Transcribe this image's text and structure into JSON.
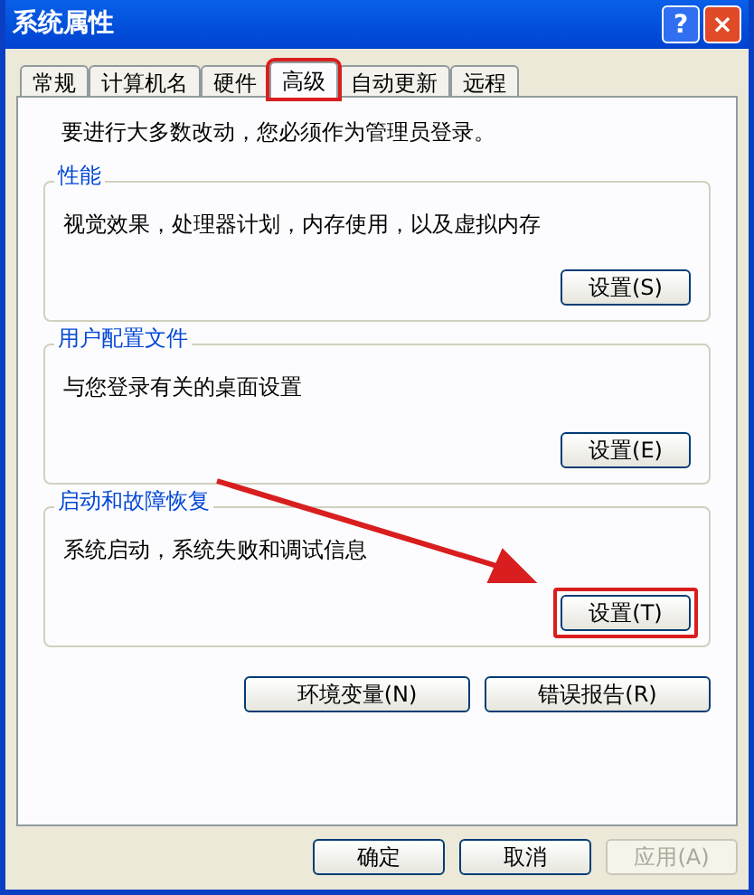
{
  "window": {
    "title": "系统属性",
    "buttons": [
      {
        "kind": "help",
        "label": "?"
      },
      {
        "kind": "close",
        "label": "×"
      }
    ]
  },
  "tabs": [
    {
      "label": "常规",
      "selected": false,
      "annotated": false
    },
    {
      "label": "计算机名",
      "selected": false,
      "annotated": false
    },
    {
      "label": "硬件",
      "selected": false,
      "annotated": false
    },
    {
      "label": "高级",
      "selected": true,
      "annotated": true
    },
    {
      "label": "自动更新",
      "selected": false,
      "annotated": false
    },
    {
      "label": "远程",
      "selected": false,
      "annotated": false
    }
  ],
  "notice": "要进行大多数改动，您必须作为管理员登录。",
  "groups": [
    {
      "title": "性能",
      "description": "视觉效果，处理器计划，内存使用，以及虚拟内存",
      "button": "设置(S)",
      "annotated": false
    },
    {
      "title": "用户配置文件",
      "description": "与您登录有关的桌面设置",
      "button": "设置(E)",
      "annotated": false
    },
    {
      "title": "启动和故障恢复",
      "description": "系统启动，系统失败和调试信息",
      "button": "设置(T)",
      "annotated": true
    }
  ],
  "extra_buttons": [
    "环境变量(N)",
    "错误报告(R)"
  ],
  "footer_buttons": [
    {
      "label": "确定",
      "disabled": false
    },
    {
      "label": "取消",
      "disabled": false
    },
    {
      "label": "应用(A)",
      "disabled": true
    }
  ]
}
